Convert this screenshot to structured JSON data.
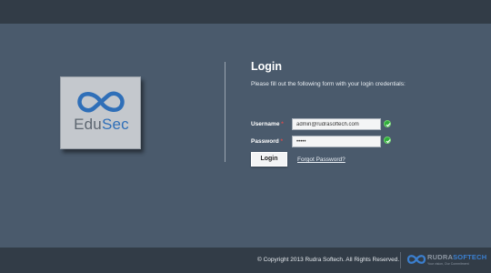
{
  "logo": {
    "edu": "Edu",
    "sec": "Sec",
    "icon": "infinity-icon"
  },
  "form": {
    "title": "Login",
    "hint": "Please fill out the following form with your login credentials:",
    "username_label": "Username",
    "password_label": "Password",
    "required_mark": "*",
    "username_value": "admin@rudrasoftech.com",
    "password_value": "•••••",
    "login_button": "Login",
    "forgot_link": "Forgot Password?"
  },
  "footer": {
    "copyright": "© Copyright 2013 Rudra Softech. All Rights Reserved.",
    "brand_rudra": "RUDRA",
    "brand_softech": "SOFTECH",
    "brand_tagline": "Your vision, Our Commitment"
  },
  "colors": {
    "background": "#4a5a6c",
    "bars": "#323c47",
    "accent": "#2f6fb8",
    "valid": "#2fae3a"
  }
}
